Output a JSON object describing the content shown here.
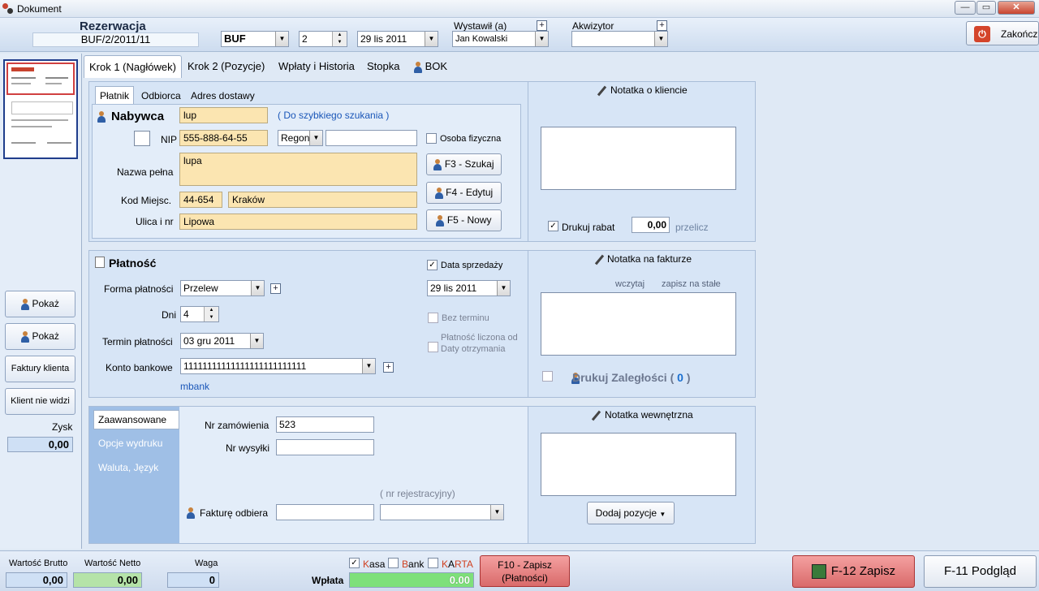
{
  "window": {
    "title": "Dokument",
    "minimize": "—",
    "maximize": "▭",
    "close": "✕"
  },
  "header": {
    "doc_type": "Rezerwacja",
    "doc_number": "BUF/2/2011/11",
    "series": "BUF",
    "number": "2",
    "date": "29  lis  2011",
    "issued_by_label": "Wystawił (a)",
    "issued_by": "Jan Kowalski",
    "acquirer_label": "Akwizytor",
    "acquirer": "",
    "finish_label": "Zakończ"
  },
  "left": {
    "show_btn_1": "Pokaż",
    "show_btn_2": "Pokaż",
    "client_invoices": "Faktury klienta",
    "client_not_seen": "Klient nie widzi",
    "profit_label": "Zysk",
    "profit_value": "0,00"
  },
  "tabs": [
    "Krok 1 (Nagłówek)",
    "Krok 2 (Pozycje)",
    "Wpłaty i Historia",
    "Stopka",
    "BOK"
  ],
  "buyer": {
    "subtabs": [
      "Płatnik",
      "Odbiorca",
      "Adres dostawy"
    ],
    "title": "Nabywca",
    "search_value": "lup",
    "search_hint": "( Do szybkiego szukania )",
    "nip_label": "NIP",
    "nip": "555-888-64-55",
    "regon_select": "Regon",
    "regon_value": "",
    "private_label": "Osoba fizyczna",
    "full_name_label": "Nazwa pełna",
    "full_name": "lupa",
    "postal_label": "Kod  Miejsc.",
    "postal": "44-654",
    "city": "Kraków",
    "street_label": "Ulica i nr",
    "street": "Lipowa",
    "f3": "F3 - Szukaj",
    "f4": "F4 - Edytuj",
    "f5": "F5 - Nowy"
  },
  "client_note": {
    "title": "Notatka o kliencie",
    "print_discount_label": "Drukuj rabat",
    "discount": "0,00",
    "recalc": "przelicz"
  },
  "payment": {
    "title": "Płatność",
    "form_label": "Forma płatności",
    "form": "Przelew",
    "days_label": "Dni",
    "days": "4",
    "due_label": "Termin płatności",
    "due": "03  gru  2011",
    "account_label": "Konto bankowe",
    "account": "11111111111111111111111111",
    "bank": "mbank",
    "sale_date_label": "Data sprzedaży",
    "sale_date": "29  lis  2011",
    "no_term_label": "Bez terminu",
    "counted_from_label": "Płatność liczona od Daty otrzymania"
  },
  "invoice_note": {
    "title": "Notatka na fakturze",
    "load": "wczytaj",
    "save_permanent": "zapisz na stałe",
    "print_overdue": "Drukuj Zaległości (",
    "overdue_count": "0",
    "overdue_close": ")"
  },
  "advanced": {
    "tabs": [
      "Zaawansowane",
      "Opcje wydruku",
      "Waluta,  Język"
    ],
    "order_no_label": "Nr zamówienia",
    "order_no": "523",
    "shipment_label": "Nr wysyłki",
    "shipment": "",
    "registration_hint": "( nr rejestracyjny)",
    "receiver_label": "Fakturę odbiera",
    "receiver": "",
    "registration": ""
  },
  "internal_note": {
    "title": "Notatka wewnętrzna",
    "add_items": "Dodaj pozycje"
  },
  "footer": {
    "gross_label": "Wartość Brutto",
    "gross": "0,00",
    "net_label": "Wartość Netto",
    "net": "0,00",
    "weight_label": "Waga",
    "weight": "0",
    "kasa_first": "K",
    "kasa_rest": "asa",
    "bank_first": "B",
    "bank_rest": "ank",
    "karta_first": "K",
    "karta_a": "A",
    "karta_rest": "RTA",
    "payment_label": "Wpłata",
    "payment": "0.00",
    "f10_line1": "F10 - Zapisz",
    "f10_line2": "(Płatności)",
    "f12": "F-12 Zapisz",
    "f11": "F-11 Podgląd"
  },
  "colors": {
    "accent_red": "#c8432e",
    "yellow_field": "#fbe5b1",
    "green_field": "#b5e3a8",
    "blue_link": "#1a56b8"
  }
}
